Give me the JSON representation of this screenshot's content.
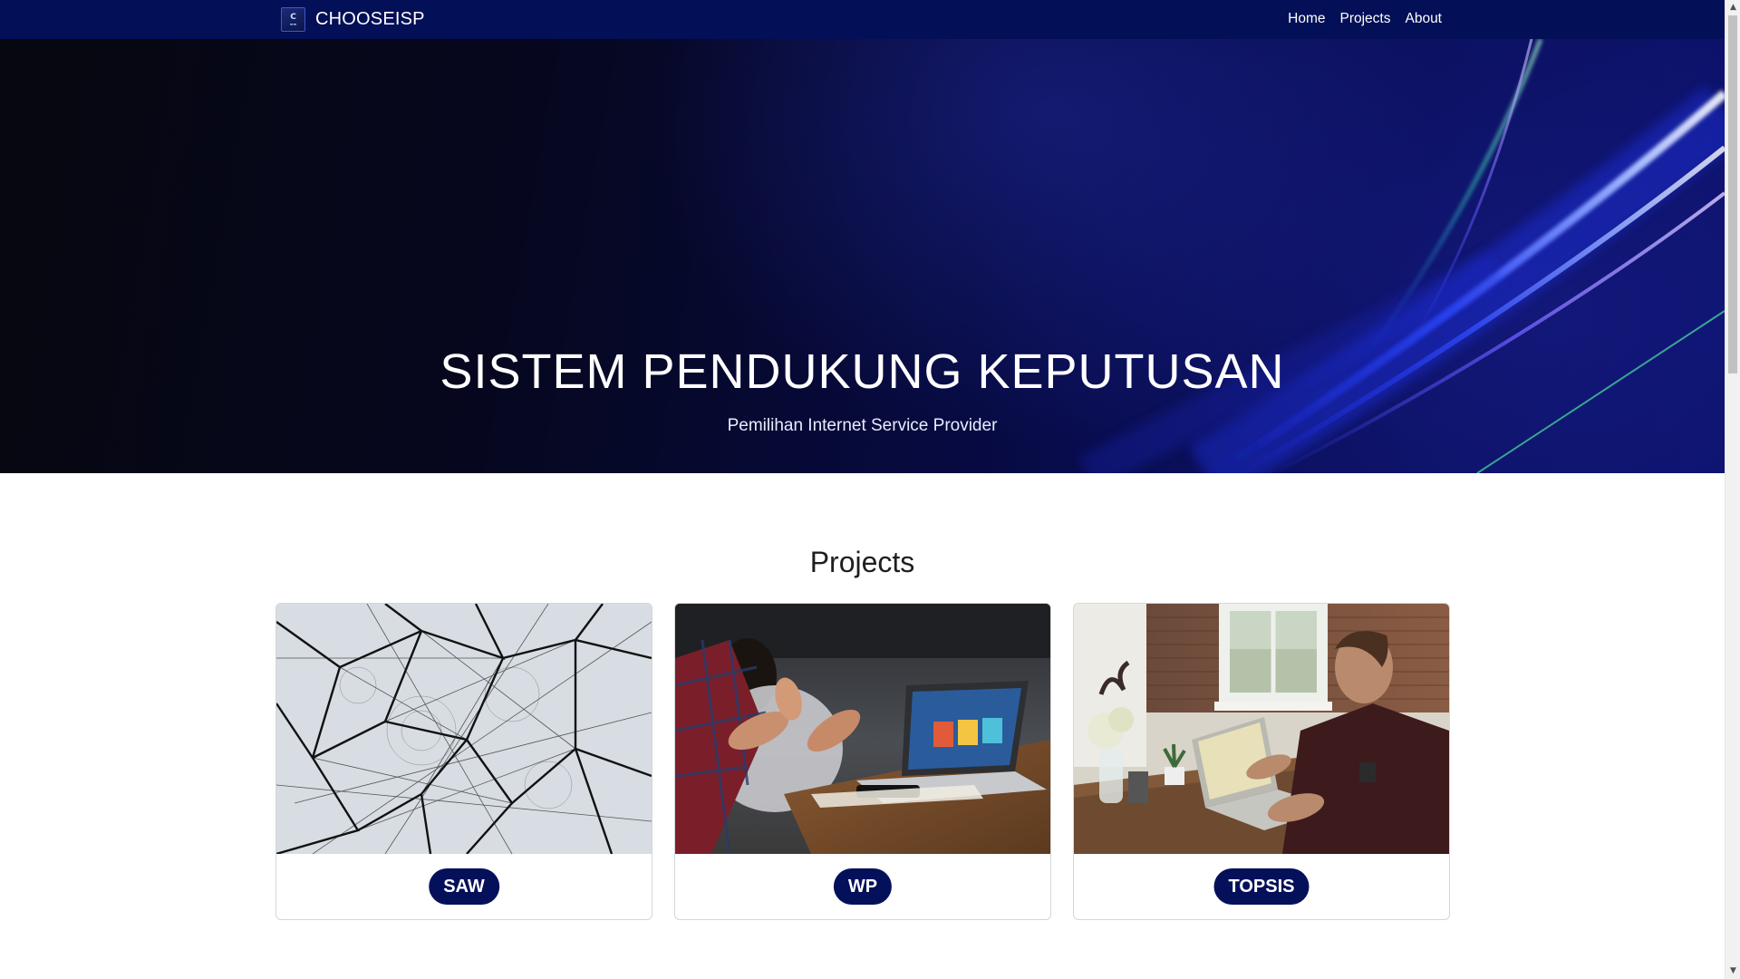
{
  "navbar": {
    "brand_name": "CHOOSEISP",
    "logo_letter": "C",
    "links": [
      "Home",
      "Projects",
      "About"
    ]
  },
  "hero": {
    "title": "SISTEM PENDUKUNG KEPUTUSAN",
    "subtitle": "Pemilihan Internet Service Provider"
  },
  "projects": {
    "heading": "Projects",
    "cards": [
      {
        "label": "SAW",
        "image": "network-wire-sculpture"
      },
      {
        "label": "WP",
        "image": "meeting-laptop-hands"
      },
      {
        "label": "TOPSIS",
        "image": "man-working-laptop-desk"
      }
    ]
  },
  "colors": {
    "navbar": "#030f56",
    "badge": "#05105a",
    "hero_streak": "#3d5dff"
  },
  "icons": {
    "scroll_up": "scroll-up-arrow-icon",
    "scroll_down": "scroll-down-arrow-icon"
  }
}
